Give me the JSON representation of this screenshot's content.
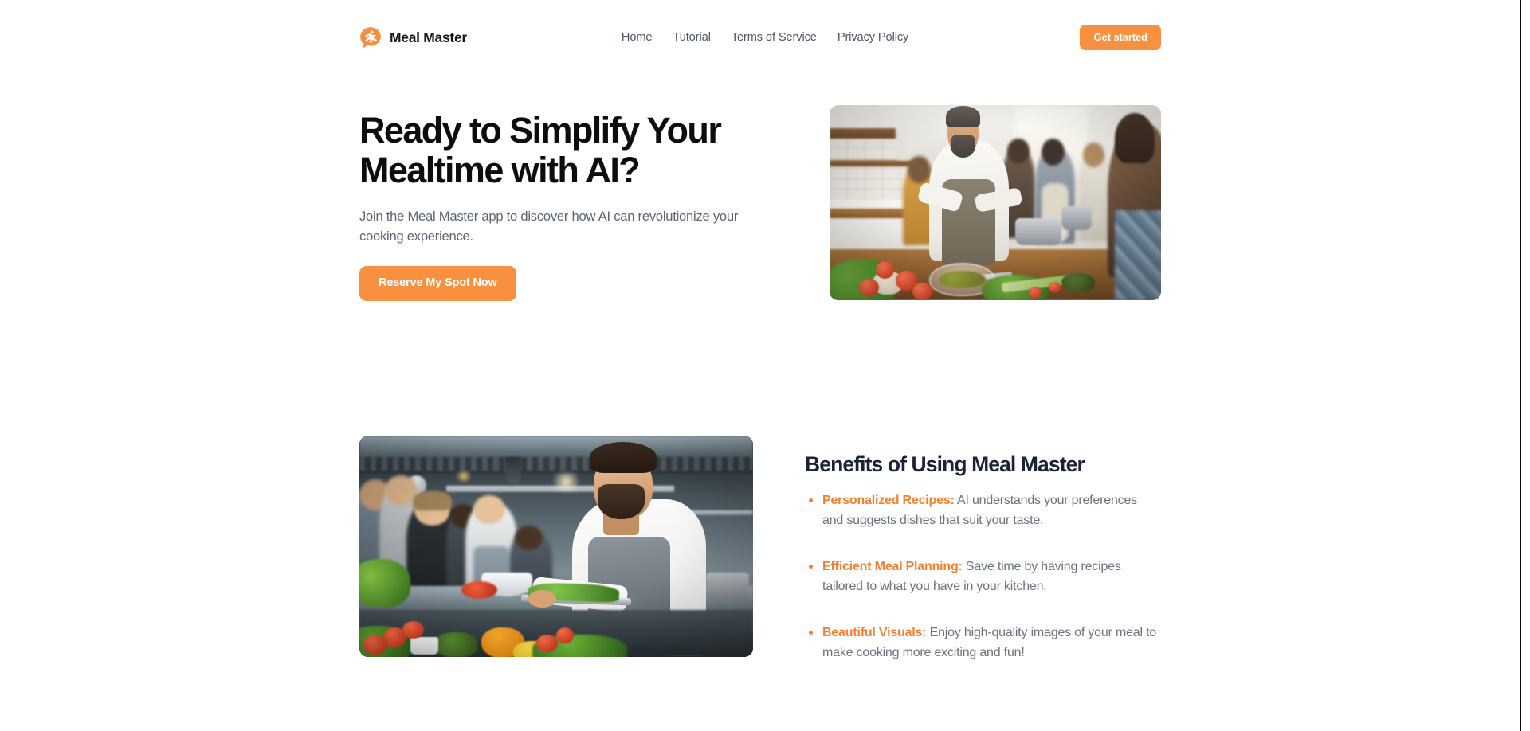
{
  "header": {
    "brand": {
      "name": "Meal Master",
      "logo_icon": "chef-speech-bubble-icon",
      "logo_color": "#f7913f"
    },
    "nav": [
      {
        "label": "Home"
      },
      {
        "label": "Tutorial"
      },
      {
        "label": "Terms of Service"
      },
      {
        "label": "Privacy Policy"
      }
    ],
    "cta": {
      "label": "Get started",
      "color": "#f7913f"
    }
  },
  "hero": {
    "title": "Ready to Simplify Your Mealtime with AI?",
    "title_line1": "Ready to Simplify Your",
    "title_line2": "Mealtime with AI?",
    "subtitle": "Join the Meal Master app to discover how AI can revolutionize your cooking experience.",
    "cta": {
      "label": "Reserve My Spot Now",
      "color": "#f7913f"
    },
    "image": {
      "alt": "Chef chopping vegetables at a kitchen island while a group of people watch a cooking class"
    }
  },
  "benefits": {
    "title": "Benefits of Using Meal Master",
    "image": {
      "alt": "Chef holding a tray of fresh greens in a commercial kitchen with students in the background"
    },
    "items": [
      {
        "label": "Personalized Recipes:",
        "text": " AI understands your preferences and suggests dishes that suit your taste."
      },
      {
        "label": "Efficient Meal Planning:",
        "text": " Save time by having recipes tailored to what you have in your kitchen."
      },
      {
        "label": "Beautiful Visuals:",
        "text": " Enjoy high-quality images of your meal to make cooking more exciting and fun!"
      }
    ],
    "accent_color": "#f2802f"
  }
}
